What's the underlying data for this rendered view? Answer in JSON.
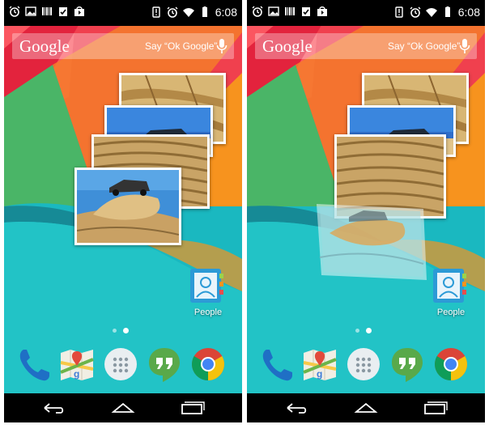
{
  "screens": [
    {
      "status": {
        "time": "6:08"
      },
      "search": {
        "logo": "Google",
        "hint": "Say “Ok Google”"
      },
      "shortcut": {
        "label": "People"
      },
      "photo_stack_state": "resting"
    },
    {
      "status": {
        "time": "6:08"
      },
      "search": {
        "logo": "Google",
        "hint": "Say “Ok Google”"
      },
      "shortcut": {
        "label": "People"
      },
      "photo_stack_state": "front-photo-dragging"
    }
  ],
  "dock_apps": [
    "phone-icon",
    "maps-icon",
    "app-drawer-icon",
    "hangouts-icon",
    "chrome-icon"
  ],
  "nav_buttons": [
    "back-button",
    "home-button",
    "recents-button"
  ],
  "colors": {
    "wall_red": "#f0404e",
    "wall_orange": "#f7931e",
    "wall_green": "#3cb878",
    "wall_teal": "#1ab8c0",
    "wall_darkteal": "#168a96",
    "statusbar": "#000000",
    "hangouts_green": "#59a94a",
    "phone_blue": "#1f6fc5"
  }
}
